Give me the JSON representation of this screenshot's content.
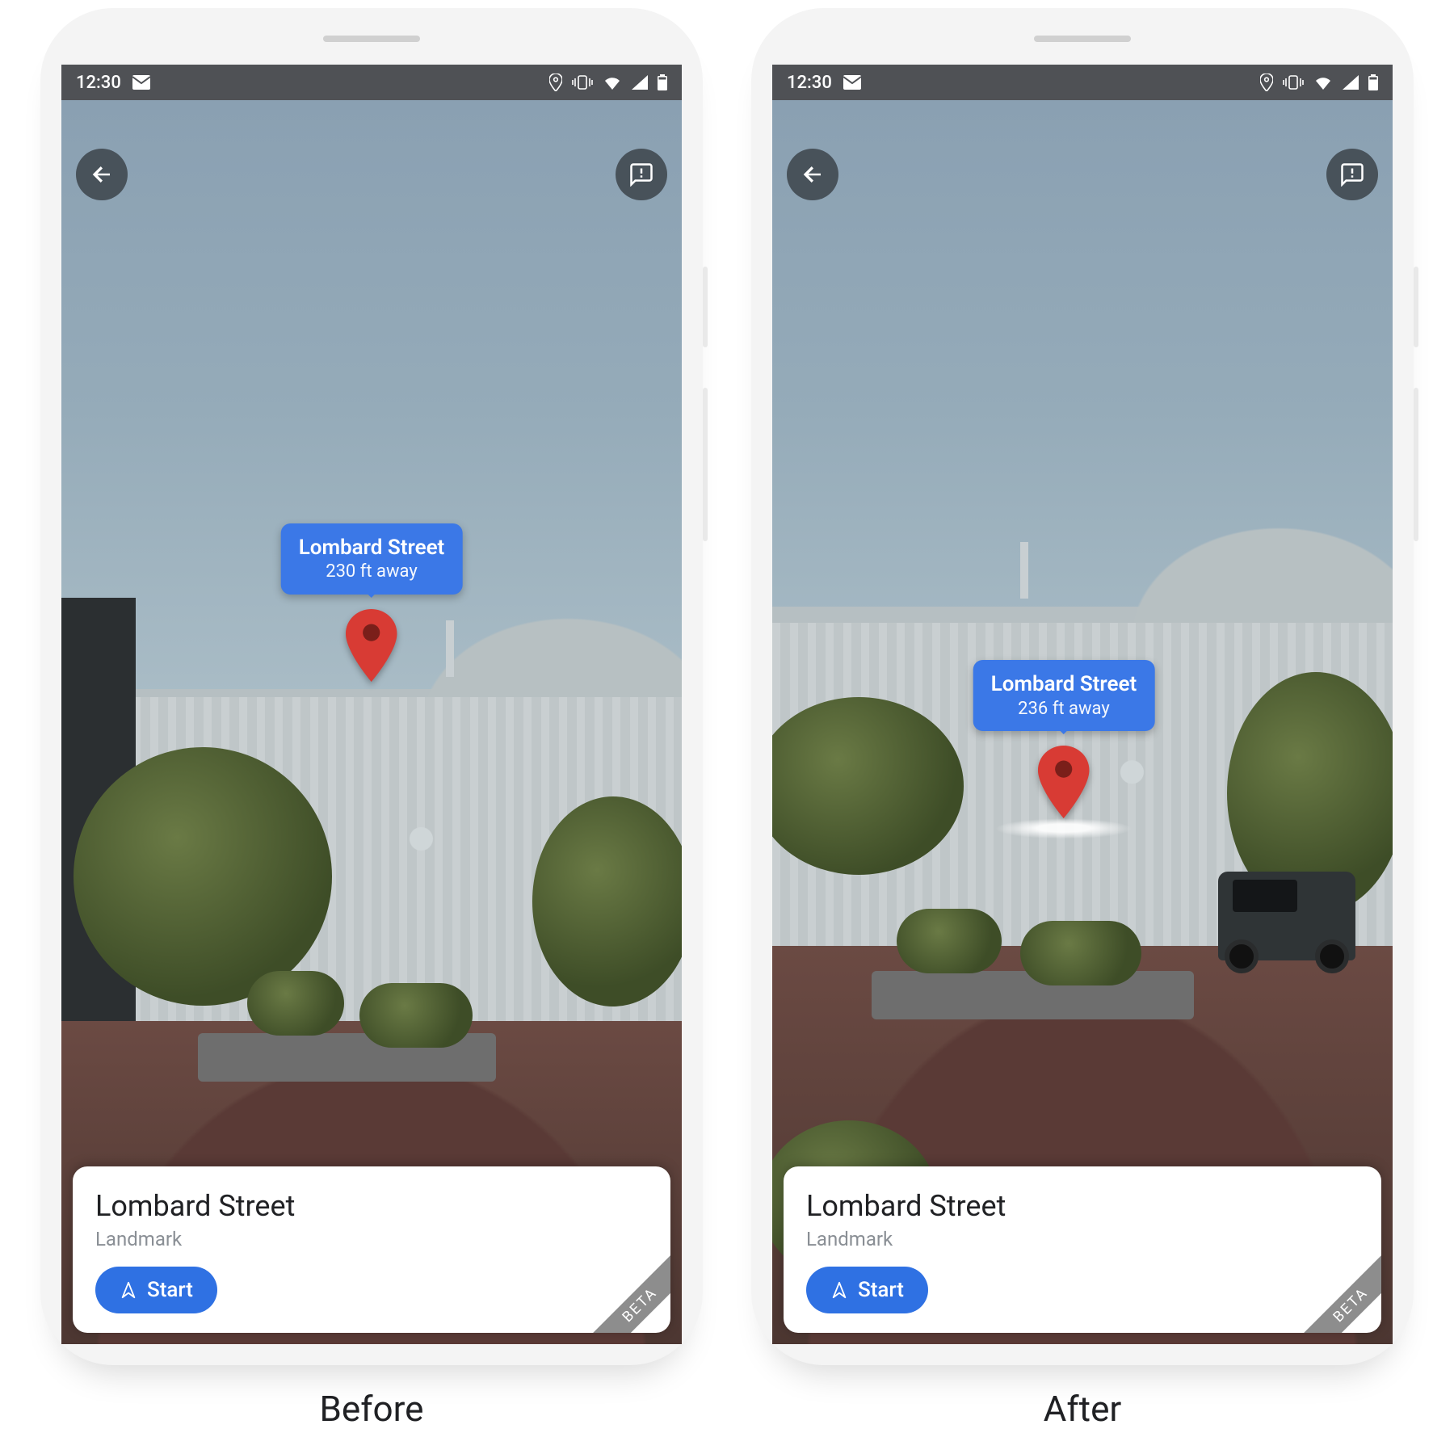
{
  "captions": {
    "left": "Before",
    "right": "After"
  },
  "status": {
    "time": "12:30"
  },
  "tooltip": {
    "title": "Lombard Street",
    "before_dist": "230 ft away",
    "after_dist": "236 ft away"
  },
  "card": {
    "title": "Lombard Street",
    "subtitle": "Landmark",
    "start_label": "Start",
    "badge": "BETA"
  },
  "colors": {
    "accent": "#3b78e7",
    "button": "#2f71e3",
    "pin": "#d83b34"
  }
}
